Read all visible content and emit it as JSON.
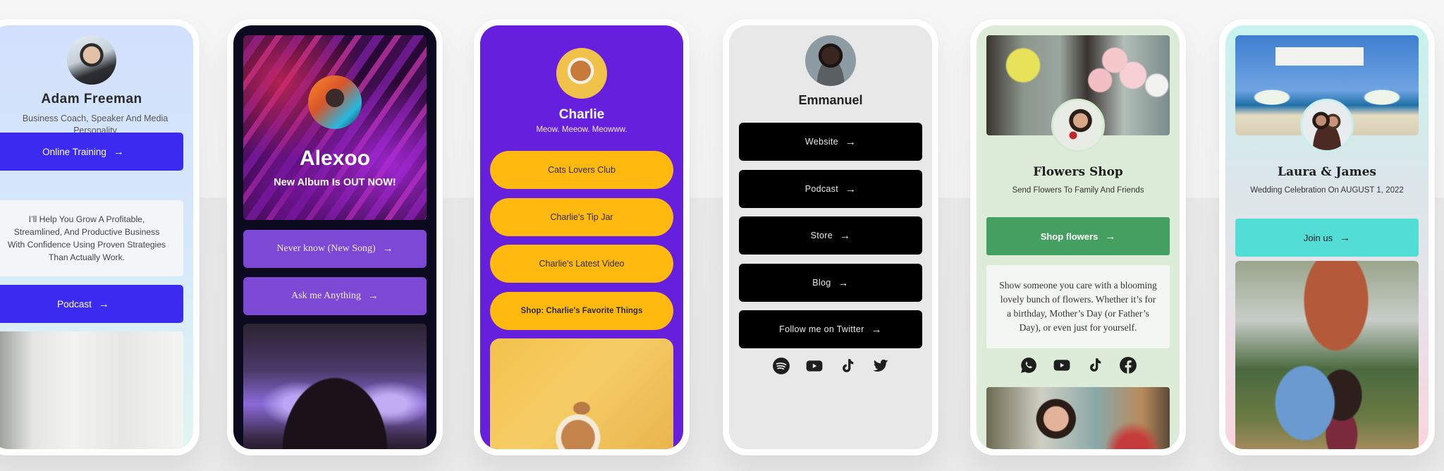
{
  "cards": [
    {
      "id": "adam",
      "name": "Adam Freeman",
      "bio": "Business Coach, Speaker And Media Personality",
      "links": [
        {
          "label": "Online Training"
        },
        {
          "label": "Podcast"
        }
      ],
      "quote": "I’ll Help You Grow A Profitable, Streamlined, And Productive Business With Confidence Using Proven Strategies Than Actually Work.",
      "colors": {
        "button": "#3b2bf0",
        "background": "#d3e0fd"
      }
    },
    {
      "id": "alexoo",
      "name": "Alexoo",
      "tagline": "New Album Is OUT NOW!",
      "links": [
        {
          "label": "Never know (New Song)"
        },
        {
          "label": "Ask me Anything"
        }
      ],
      "colors": {
        "button": "#7c48d4",
        "background": "#0c0a1f"
      }
    },
    {
      "id": "charlie",
      "name": "Charlie",
      "tagline": "Meow. Meeow. Meowww.",
      "links": [
        {
          "label": "Cats Lovers Club"
        },
        {
          "label": "Charlie's Tip Jar"
        },
        {
          "label": "Charlie's Latest Video"
        },
        {
          "label": "Shop: Charlie's Favorite Things"
        }
      ],
      "colors": {
        "button": "#ffb90f",
        "background": "#661fdc"
      }
    },
    {
      "id": "emmanuel",
      "name": "Emmanuel",
      "links": [
        {
          "label": "Website"
        },
        {
          "label": "Podcast"
        },
        {
          "label": "Store"
        },
        {
          "label": "Blog"
        },
        {
          "label": "Follow me on Twitter"
        }
      ],
      "social_icons": [
        "spotify-icon",
        "youtube-icon",
        "tiktok-icon",
        "twitter-icon"
      ],
      "colors": {
        "button": "#000000",
        "background": "#e8e8e8"
      }
    },
    {
      "id": "flowers",
      "name": "Flowers Shop",
      "tagline": "Send Flowers To Family And Friends",
      "links": [
        {
          "label": "Shop flowers"
        }
      ],
      "description": "Show someone you care with a blooming lovely bunch of flowers. Whether it’s for a birthday, Mother’s Day (or Father’s Day), or even just for yourself.",
      "social_icons": [
        "whatsapp-icon",
        "youtube-icon",
        "tiktok-icon",
        "facebook-icon"
      ],
      "colors": {
        "button": "#44a060",
        "background": "#dcecd9"
      }
    },
    {
      "id": "wedding",
      "name": "Laura & James",
      "tagline": "Wedding Celebration On AUGUST 1, 2022",
      "links": [
        {
          "label": "Join us"
        }
      ],
      "colors": {
        "button": "#52ddd6",
        "background": "#c7f3ee"
      }
    }
  ],
  "arrow_glyph": "→"
}
